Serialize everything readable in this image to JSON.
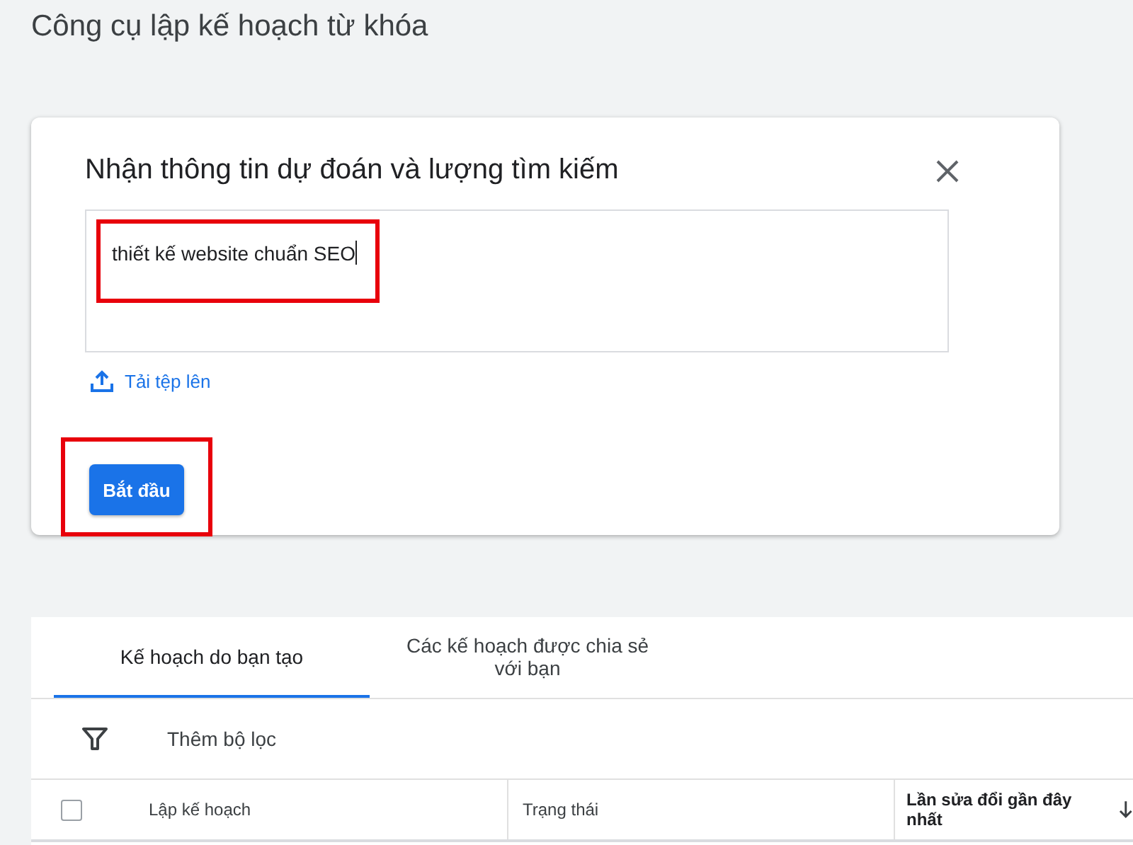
{
  "page_title": "Công cụ lập kế hoạch từ khóa",
  "dialog": {
    "title": "Nhận thông tin dự đoán và lượng tìm kiếm",
    "keywords": {
      "value": "thiết kế website chuẩn SEO",
      "highlighted": true
    },
    "upload_link": "Tải tệp lên",
    "start_button": {
      "label": "Bắt đầu",
      "highlighted": true
    }
  },
  "tabs": [
    {
      "label": "Kế hoạch do bạn tạo",
      "selected": true
    },
    {
      "label": "Các kế hoạch được chia sẻ với bạn",
      "selected": false
    }
  ],
  "filter": "Thêm bộ lọc",
  "table": {
    "select_all_checked": false,
    "columns": [
      {
        "label": "Lập kế hoạch",
        "sorted": false
      },
      {
        "label": "Trạng thái",
        "sorted": false
      },
      {
        "label": "Lần sửa đổi gần đây nhất",
        "sorted": true
      }
    ]
  }
}
